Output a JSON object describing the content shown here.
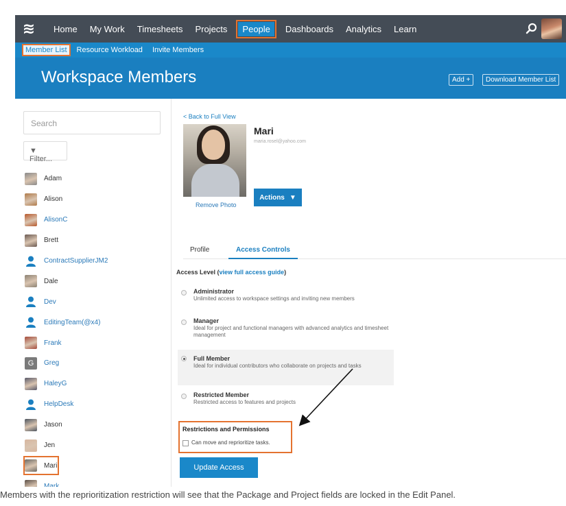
{
  "nav": {
    "logo": "≋",
    "items": [
      "Home",
      "My Work",
      "Timesheets",
      "Projects",
      "People",
      "Dashboards",
      "Analytics",
      "Learn"
    ],
    "active_item": "People"
  },
  "subnav": {
    "items": [
      "Member List",
      "Resource Workload",
      "Invite Members"
    ],
    "active_item": "Member List"
  },
  "header": {
    "title": "Workspace Members",
    "add_button": "Add +",
    "download_button": "Download Member List"
  },
  "sidebar": {
    "search_placeholder": "Search",
    "filter_label": "Filter...",
    "members": [
      {
        "name": "Adam",
        "style": "dark",
        "avatar": "photo",
        "color": "#8a8a8a"
      },
      {
        "name": "Alison",
        "style": "dark",
        "avatar": "photo",
        "color": "#b07b4a"
      },
      {
        "name": "AlisonC",
        "style": "blue",
        "avatar": "photo",
        "color": "#b8592c"
      },
      {
        "name": "Brett",
        "style": "dark",
        "avatar": "photo",
        "color": "#6b5a52"
      },
      {
        "name": "ContractSupplierJM2",
        "style": "blue",
        "avatar": "person-icon",
        "color": "#1a7fc0"
      },
      {
        "name": "Dale",
        "style": "dark",
        "avatar": "photo",
        "color": "#8d8374"
      },
      {
        "name": "Dev",
        "style": "blue",
        "avatar": "person-icon",
        "color": "#1a7fc0"
      },
      {
        "name": "EditingTeam(@x4)",
        "style": "blue",
        "avatar": "person-icon",
        "color": "#1a7fc0"
      },
      {
        "name": "Frank",
        "style": "blue",
        "avatar": "photo",
        "color": "#a54a3a"
      },
      {
        "name": "Greg",
        "style": "blue",
        "avatar": "letter",
        "color": "#7a7a7a"
      },
      {
        "name": "HaleyG",
        "style": "blue",
        "avatar": "photo",
        "color": "#5a5a6a"
      },
      {
        "name": "HelpDesk",
        "style": "blue",
        "avatar": "person-icon",
        "color": "#1a7fc0"
      },
      {
        "name": "Jason",
        "style": "dark",
        "avatar": "photo",
        "color": "#4e5660"
      },
      {
        "name": "Jen",
        "style": "dark",
        "avatar": "photo",
        "color": "#d8b7a0"
      },
      {
        "name": "Mari",
        "style": "dark",
        "avatar": "photo",
        "color": "#6d6b66",
        "selected": true
      },
      {
        "name": "Mark",
        "style": "blue",
        "avatar": "photo",
        "color": "#5c5047"
      }
    ]
  },
  "profile": {
    "back_link": "< Back to Full View",
    "name": "Mari",
    "email": "maria.rosel@yahoo.com",
    "remove_photo": "Remove Photo",
    "actions_label": "Actions",
    "actions_caret": "▼"
  },
  "tabs": [
    "Profile",
    "Access Controls"
  ],
  "active_tab": "Access Controls",
  "access": {
    "title": "Access Level (",
    "guide_link": "view full access guide",
    "title_close": ")",
    "levels": [
      {
        "title": "Administrator",
        "desc": "Unlimited access to workspace settings and inviting new members",
        "checked": false
      },
      {
        "title": "Manager",
        "desc": "Ideal for project and functional managers with advanced analytics and timesheet management",
        "checked": false
      },
      {
        "title": "Full Member",
        "desc": "Ideal for individual contributors who collaborate on projects and tasks",
        "checked": true
      },
      {
        "title": "Restricted Member",
        "desc": "Restricted access to features and projects",
        "checked": false
      }
    ]
  },
  "restrictions": {
    "title": "Restrictions and Permissions",
    "option_label": "Can move and reprioritize tasks.",
    "checked": false
  },
  "update_button": "Update Access",
  "caption": "Members with the reprioritization restriction will see that the Package and Project fields are locked in the Edit Panel.",
  "colors": {
    "nav_bg": "#444c56",
    "accent_blue": "#1a88c9",
    "highlight_orange": "#e4722f"
  }
}
